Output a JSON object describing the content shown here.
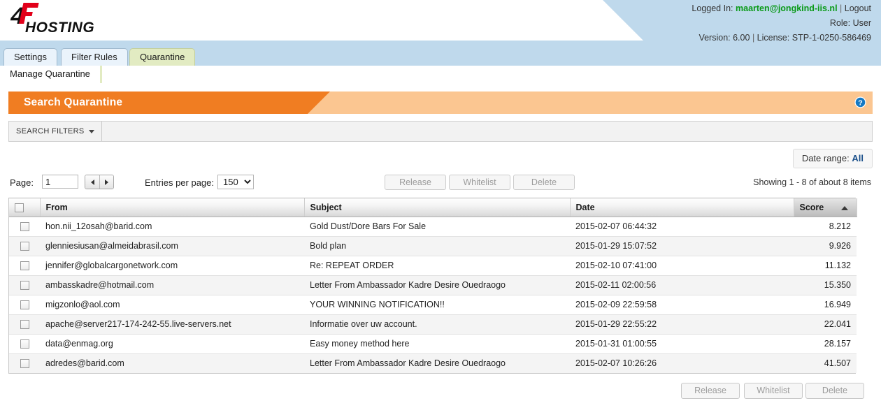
{
  "header": {
    "logo_text_top": "4F",
    "logo_text_bottom": "HOSTING",
    "logged_in_label": "Logged In:",
    "user_email": "maarten@jongkind-iis.nl",
    "separator": "|",
    "logout_label": "Logout",
    "role_label": "Role:",
    "role_value": "User",
    "version_label": "Version:",
    "version_value": "6.00",
    "license_label": "License:",
    "license_value": "STP-1-0250-586469"
  },
  "tabs": [
    {
      "label": "Settings",
      "active": false
    },
    {
      "label": "Filter Rules",
      "active": false
    },
    {
      "label": "Quarantine",
      "active": true
    }
  ],
  "subtab": {
    "label": "Manage Quarantine"
  },
  "panel": {
    "title": "Search Quarantine",
    "help_icon": "help-circle-icon",
    "search_filters_label": "SEARCH FILTERS",
    "daterange_label": "Date range:",
    "daterange_value": "All"
  },
  "toolbar": {
    "page_label": "Page:",
    "page_value": "1",
    "prev_icon": "triangle-left-icon",
    "next_icon": "triangle-right-icon",
    "entries_label": "Entries per page:",
    "entries_value": "150",
    "entries_options": [
      "150"
    ],
    "release_label": "Release",
    "whitelist_label": "Whitelist",
    "delete_label": "Delete",
    "showing_text": "Showing 1 - 8 of about 8 items"
  },
  "table": {
    "columns": [
      "From",
      "Subject",
      "Date",
      "Score"
    ],
    "sorted_column": "Score",
    "sort_direction": "asc",
    "rows": [
      {
        "from": "hon.nii_12osah@barid.com",
        "subject": "Gold Dust/Dore Bars For Sale",
        "date": "2015-02-07 06:44:32",
        "score": "8.212"
      },
      {
        "from": "glenniesiusan@almeidabrasil.com",
        "subject": "Bold plan",
        "date": "2015-01-29 15:07:52",
        "score": "9.926"
      },
      {
        "from": "jennifer@globalcargonetwork.com",
        "subject": "Re: REPEAT ORDER",
        "date": "2015-02-10 07:41:00",
        "score": "11.132"
      },
      {
        "from": "ambasskadre@hotmail.com",
        "subject": "Letter From Ambassador Kadre Desire Ouedraogo",
        "date": "2015-02-11 02:00:56",
        "score": "15.350"
      },
      {
        "from": "migzonlo@aol.com",
        "subject": "YOUR WINNING NOTIFICATION!!",
        "date": "2015-02-09 22:59:58",
        "score": "16.949"
      },
      {
        "from": "apache@server217-174-242-55.live-servers.net",
        "subject": "Informatie over uw account.",
        "date": "2015-01-29 22:55:22",
        "score": "22.041"
      },
      {
        "from": "data@enmag.org",
        "subject": "Easy money method here",
        "date": "2015-01-31 01:00:55",
        "score": "28.157"
      },
      {
        "from": "adredes@barid.com",
        "subject": "Letter From Ambassador Kadre Desire Ouedraogo",
        "date": "2015-02-07 10:26:26",
        "score": "41.507"
      }
    ]
  },
  "bottom_buttons": {
    "release_label": "Release",
    "whitelist_label": "Whitelist",
    "delete_label": "Delete"
  },
  "colors": {
    "header_blue": "#bfd9ec",
    "tab_active_green": "#e2ebc2",
    "title_orange_dark": "#f07d22",
    "title_orange_light": "#fbc691",
    "user_green": "#0a9a18",
    "link_blue": "#1a4f8a",
    "logo_red": "#e2001a"
  }
}
